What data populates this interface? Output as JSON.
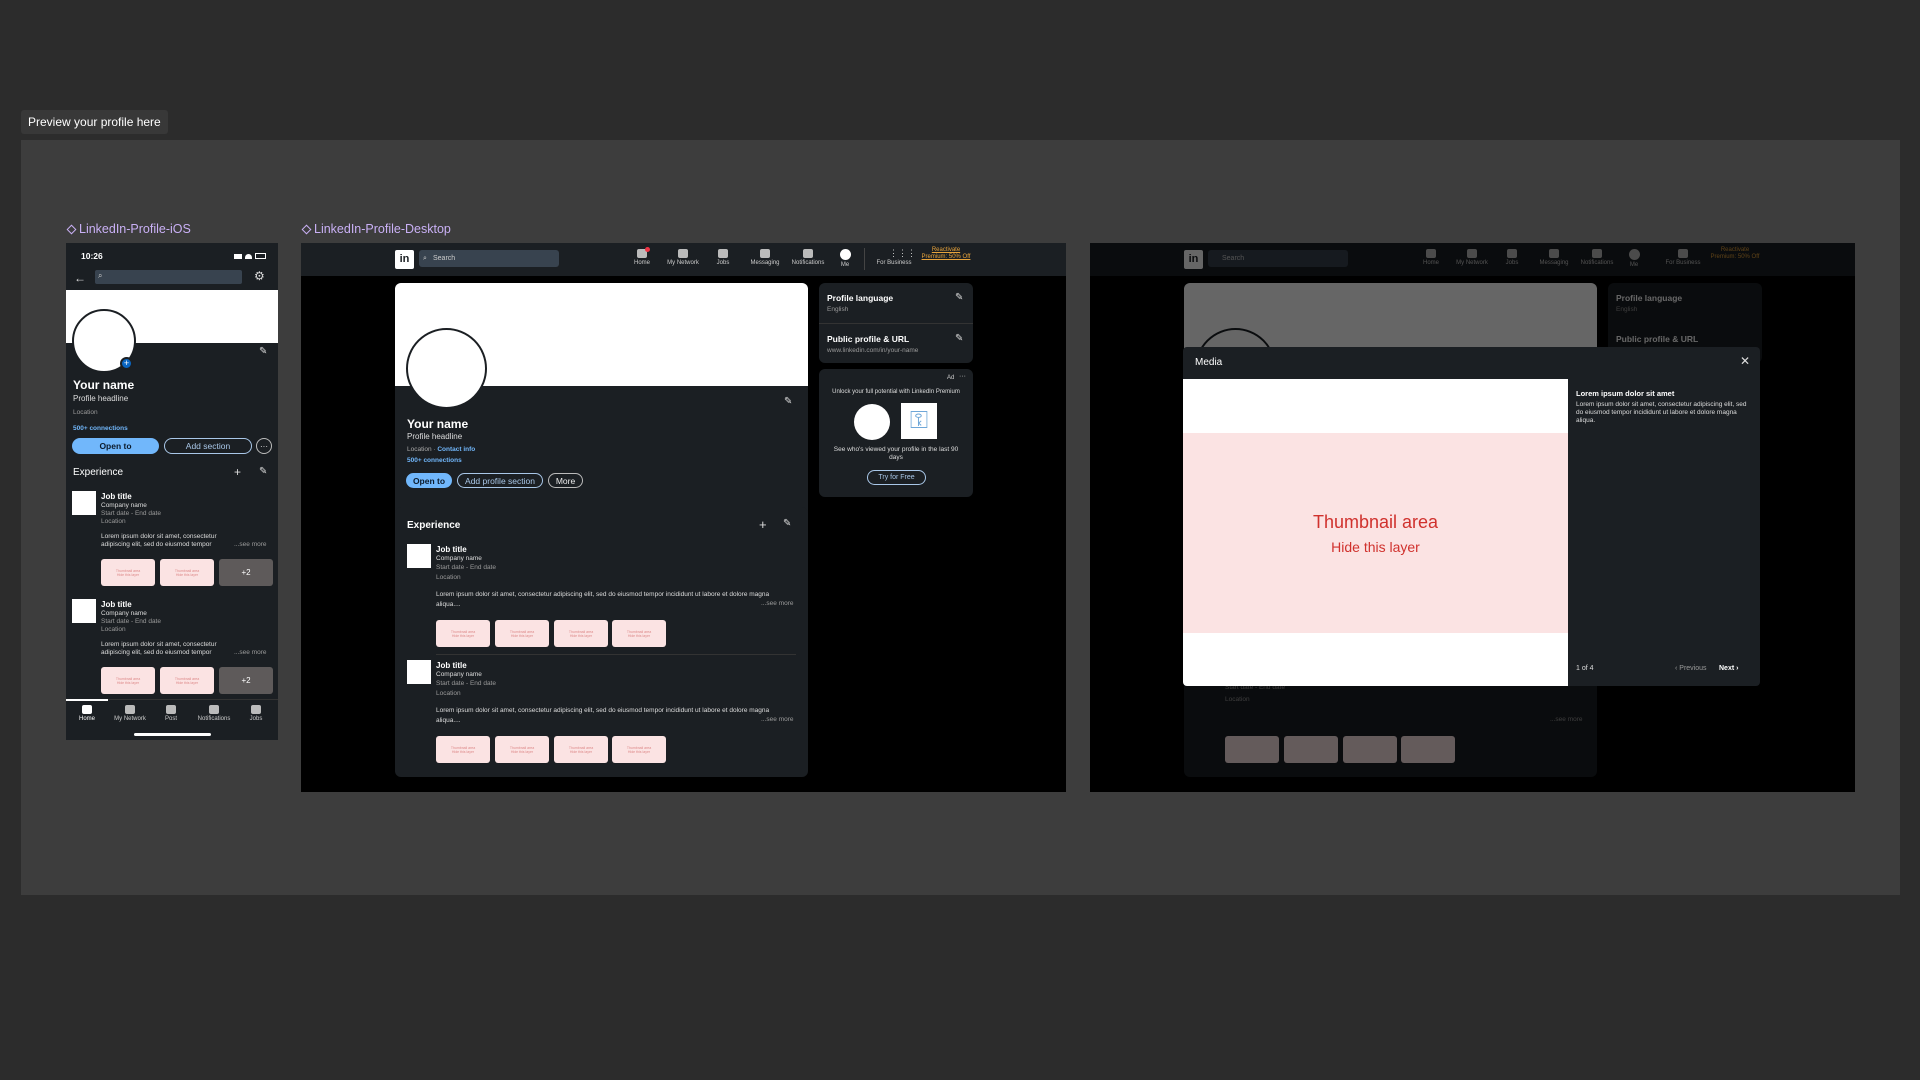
{
  "preview_tag": "Preview your profile here",
  "frames": {
    "ios_label": "LinkedIn-Profile-iOS",
    "desktop_label": "LinkedIn-Profile-Desktop"
  },
  "ios": {
    "time": "10:26",
    "name": "Your name",
    "headline": "Profile headline",
    "location": "Location",
    "connections": "500+ connections",
    "open_to": "Open to",
    "add_section": "Add section",
    "experience_title": "Experience",
    "jobs": [
      {
        "title": "Job title",
        "company": "Company name",
        "dates": "Start date - End date",
        "location": "Location",
        "desc": "Lorem ipsum dolor sit amet, consectetur adipiscing elit, sed do eiusmod tempor",
        "see_more": "...see more",
        "more_count": "+2"
      },
      {
        "title": "Job title",
        "company": "Company name",
        "dates": "Start date - End date",
        "location": "Location",
        "desc": "Lorem ipsum dolor sit amet, consectetur adipiscing elit, sed do eiusmod tempor",
        "see_more": "...see more",
        "more_count": "+2"
      }
    ],
    "tabs": [
      "Home",
      "My Network",
      "Post",
      "Notifications",
      "Jobs"
    ]
  },
  "desktop": {
    "search_placeholder": "Search",
    "nav": [
      "Home",
      "My Network",
      "Jobs",
      "Messaging",
      "Notifications",
      "Me",
      "For Business"
    ],
    "premium_link": "Reactivate Premium: 50% Off",
    "name": "Your name",
    "headline": "Profile headline",
    "location": "Location",
    "contact_info": "Contact info",
    "connections": "500+ connections",
    "open_to": "Open to",
    "add_profile_section": "Add profile section",
    "more": "More",
    "profile_language_title": "Profile language",
    "profile_language_value": "English",
    "public_profile_title": "Public profile & URL",
    "public_profile_url": "www.linkedin.com/in/your-name",
    "ad_label": "Ad",
    "ad_text": "Unlock your full potential with LinkedIn Premium",
    "ad_caption": "See who's viewed your profile in the last 90 days",
    "try_free": "Try for Free",
    "experience_title": "Experience",
    "jobs": [
      {
        "title": "Job title",
        "company": "Company name",
        "dates": "Start date - End date",
        "location": "Location",
        "desc": "Lorem ipsum dolor sit amet, consectetur adipiscing elit, sed do eiusmod tempor incididunt ut labore et dolore magna aliqua....",
        "see_more": "...see more"
      },
      {
        "title": "Job title",
        "company": "Company name",
        "dates": "Start date - End date",
        "location": "Location",
        "desc": "Lorem ipsum dolor sit amet, consectetur adipiscing elit, sed do eiusmod tempor incididunt ut labore et dolore magna aliqua....",
        "see_more": "...see more"
      }
    ]
  },
  "modal": {
    "title": "Media",
    "thumb_title": "Thumbnail area",
    "thumb_sub": "Hide this layer",
    "side_title": "Lorem ipsum dolor sit amet",
    "side_desc": "Lorem ipsum dolor sit amet, consectetur adipiscing elit, sed do eiusmod tempor incididunt ut labore et dolore magna aliqua.",
    "pager": "1 of 4",
    "previous": "Previous",
    "next": "Next"
  }
}
